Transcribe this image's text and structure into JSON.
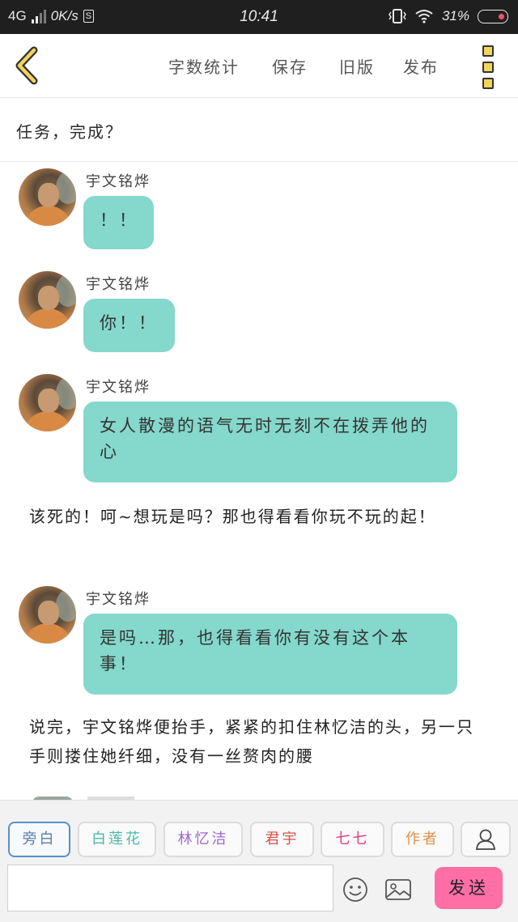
{
  "status_bar": {
    "network": "4G",
    "speed": "0K/s",
    "sim_badge": "S",
    "time": "10:41",
    "battery": "31%"
  },
  "toolbar": {
    "back_icon": "chevron-left-icon",
    "menu": [
      "字数统计",
      "保存",
      "旧版",
      "发布"
    ],
    "more_icon": "more-vertical-icon",
    "more_icon_color": "#f2d35c"
  },
  "title": "任务，完成？",
  "chat": {
    "bubble_color": "#84d8cc",
    "items": [
      {
        "type": "message",
        "speaker": "宇文铭烨",
        "text": "！！"
      },
      {
        "type": "message",
        "speaker": "宇文铭烨",
        "text": "你！！"
      },
      {
        "type": "message",
        "speaker": "宇文铭烨",
        "text": "女人散漫的语气无时无刻不在拨弄他的心"
      },
      {
        "type": "narration",
        "text": "该死的！呵~想玩是吗？那也得看看你玩不玩的起！"
      },
      {
        "type": "message",
        "speaker": "宇文铭烨",
        "text": "是吗…那，也得看看你有没有这个本事！"
      },
      {
        "type": "narration",
        "text": "说完，宇文铭烨便抬手，紧紧的扣住林忆洁的头，另一只手则搂住她纤细，没有一丝赘肉的腰"
      }
    ]
  },
  "roles": [
    {
      "label": "旁白",
      "color": "#5a7fa8",
      "active": true
    },
    {
      "label": "白莲花",
      "color": "#4cb8a8",
      "active": false
    },
    {
      "label": "林忆洁",
      "color": "#a06ac8",
      "active": false
    },
    {
      "label": "君宇",
      "color": "#d8504a",
      "active": false
    },
    {
      "label": "七七",
      "color": "#e0407a",
      "active": false
    },
    {
      "label": "作者",
      "color": "#e0904a",
      "active": false
    }
  ],
  "user_icon": "user-icon",
  "input": {
    "placeholder": "",
    "value": ""
  },
  "emoji_icon": "emoji-icon",
  "image_icon": "image-icon",
  "send_label": "发送",
  "send_color": "#ff6fa6"
}
